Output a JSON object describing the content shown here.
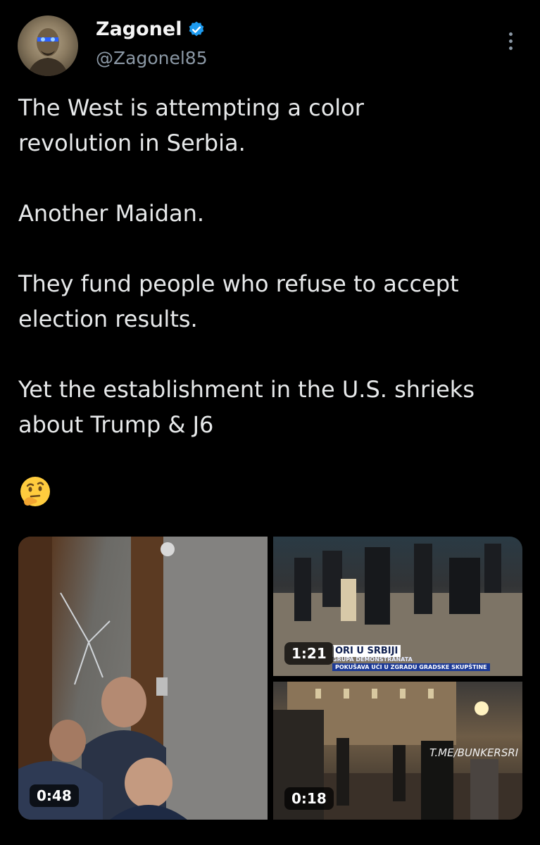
{
  "author": {
    "display_name": "Zagonel",
    "handle": "@Zagonel85",
    "verified": true
  },
  "tweet": {
    "paragraphs": [
      [
        "The West is attempting a color",
        "revolution in Serbia."
      ],
      [
        "Another Maidan."
      ],
      [
        "They fund people who refuse to accept",
        "election results."
      ],
      [
        "Yet the establishment in the U.S. shrieks",
        "about Trump & J6"
      ]
    ],
    "emoji": "thinking-face"
  },
  "media": {
    "left": {
      "duration": "0:48"
    },
    "top_right": {
      "duration": "1:21",
      "banner_top": "ORI U SRBIJI",
      "banner_mid": "GRUPA DEMONSTRANATA",
      "banner_bottom": "POKUŠAVA UĆI U ZGRADU GRADSKE SKUPŠTINE"
    },
    "bottom_right": {
      "duration": "0:18",
      "watermark": "T.ME/BUNKERSRI"
    }
  },
  "colors": {
    "background": "#000000",
    "text": "#e7e9ea",
    "secondary_text": "#8b98a5",
    "verified_blue": "#1d9bf0"
  }
}
